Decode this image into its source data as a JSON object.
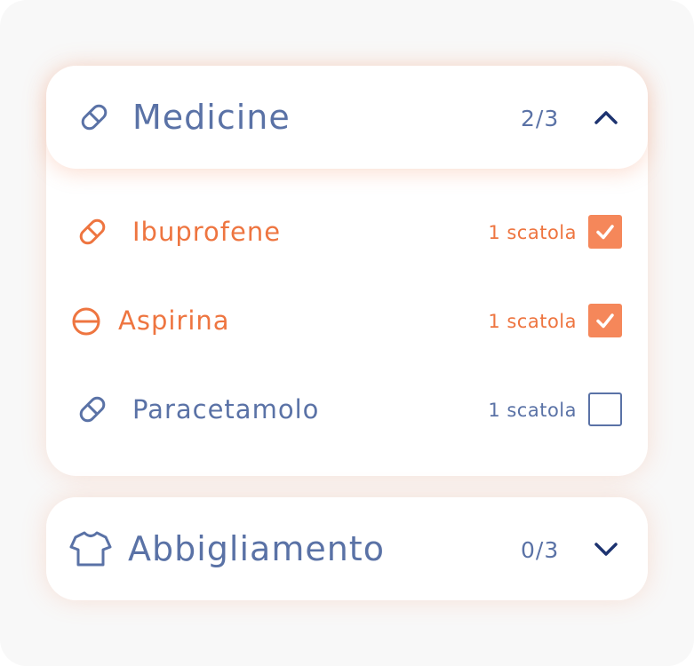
{
  "sections": [
    {
      "title": "Medicine",
      "count": "2/3",
      "icon": "pill-icon",
      "expanded": true,
      "items": [
        {
          "name": "Ibuprofene",
          "quantity": "1 scatola",
          "checked": true,
          "icon": "pill-icon"
        },
        {
          "name": "Aspirina",
          "quantity": "1 scatola",
          "checked": true,
          "icon": "tablet-icon"
        },
        {
          "name": "Paracetamolo",
          "quantity": "1 scatola",
          "checked": false,
          "icon": "pill-icon"
        }
      ]
    },
    {
      "title": "Abbigliamento",
      "count": "0/3",
      "icon": "tshirt-icon",
      "expanded": false,
      "items": []
    }
  ],
  "colors": {
    "accent": "#ee7540",
    "checkbox_fill": "#f5875a",
    "text_blue": "#5a72a6",
    "chevron": "#1d3370",
    "background": "#f8f8f8"
  }
}
